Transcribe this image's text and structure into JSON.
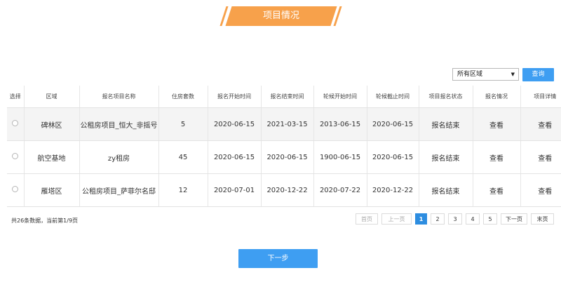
{
  "header": {
    "title": "项目情况"
  },
  "filter": {
    "region_value": "所有区域",
    "query_label": "查询"
  },
  "table": {
    "columns": [
      "选择",
      "区域",
      "报名项目名称",
      "住房套数",
      "报名开始时间",
      "报名结束时间",
      "轮候开始时间",
      "轮候截止时间",
      "项目报名状态",
      "报名情况",
      "项目详情"
    ],
    "rows": [
      {
        "region": "碑林区",
        "name": "公租房项目_恒大_非摇号",
        "units": "5",
        "reg_start": "2020-06-15",
        "reg_end": "2021-03-15",
        "wait_start": "2013-06-15",
        "wait_end": "2020-06-15",
        "status": "报名结束",
        "signup": "查看",
        "detail": "查看"
      },
      {
        "region": "航空基地",
        "name": "zy租房",
        "units": "45",
        "reg_start": "2020-06-15",
        "reg_end": "2020-06-15",
        "wait_start": "1900-06-15",
        "wait_end": "2020-06-15",
        "status": "报名结束",
        "signup": "查看",
        "detail": "查看"
      },
      {
        "region": "雁塔区",
        "name": "公租房项目_萨菲尔名邸",
        "units": "12",
        "reg_start": "2020-07-01",
        "reg_end": "2020-12-22",
        "wait_start": "2020-07-22",
        "wait_end": "2020-12-22",
        "status": "报名结束",
        "signup": "查看",
        "detail": "查看"
      }
    ]
  },
  "pagination": {
    "summary": "共26条数据，当前第1/9页",
    "first": "首页",
    "prev": "上一页",
    "pages": [
      "1",
      "2",
      "3",
      "4",
      "5"
    ],
    "next": "下一页",
    "last": "末页",
    "current_page": 1
  },
  "footer": {
    "next_step": "下一步"
  },
  "colors": {
    "accent_orange": "#f7a14b",
    "primary_blue": "#3e9ef2",
    "red_text": "#d9413a",
    "link_blue": "#2f7fd1"
  },
  "icons": {
    "dropdown": "triangle-down-icon",
    "radio": "radio-icon"
  }
}
